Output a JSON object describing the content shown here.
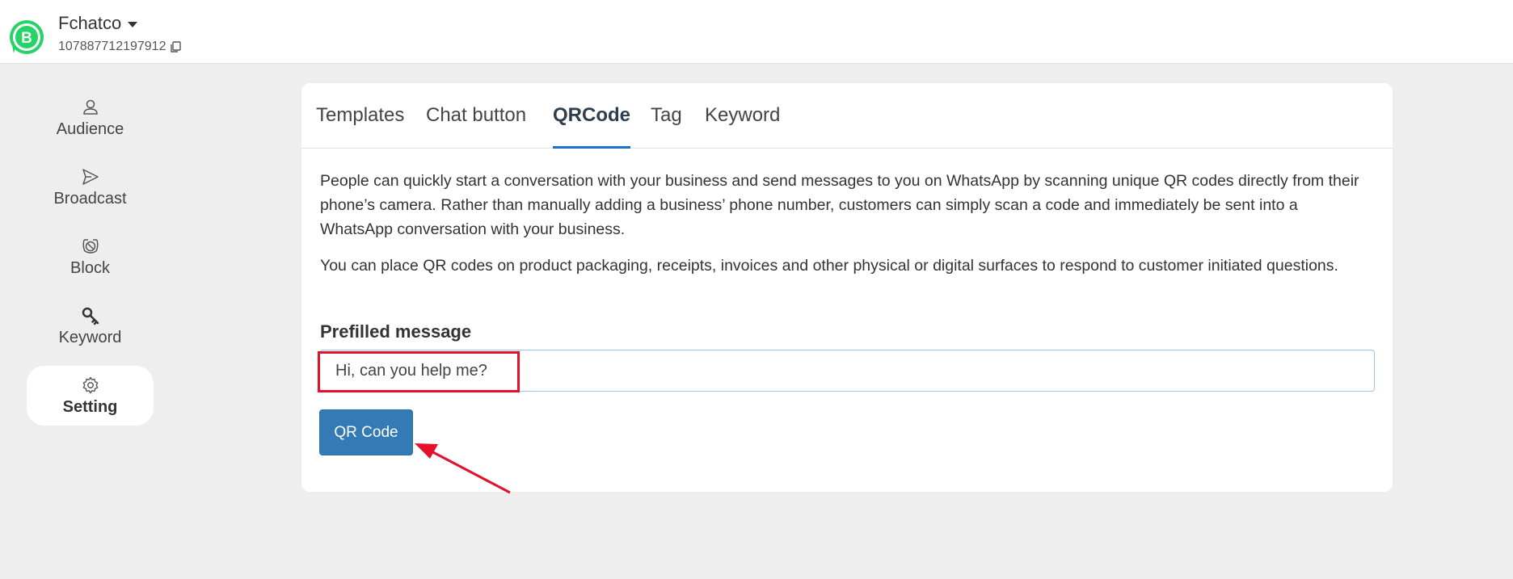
{
  "header": {
    "account_name": "Fchatco",
    "account_id": "107887712197912",
    "logo_letter": "B"
  },
  "sidebar": {
    "items": [
      {
        "label": "Audience",
        "icon": "user-icon"
      },
      {
        "label": "Broadcast",
        "icon": "send-icon"
      },
      {
        "label": "Block",
        "icon": "block-icon"
      },
      {
        "label": "Keyword",
        "icon": "key-icon"
      },
      {
        "label": "Setting",
        "icon": "gear-icon",
        "active": true
      }
    ]
  },
  "tabs": [
    {
      "label": "Templates"
    },
    {
      "label": "Chat button"
    },
    {
      "label": "QRCode",
      "active": true
    },
    {
      "label": "Tag"
    },
    {
      "label": "Keyword"
    }
  ],
  "content": {
    "paragraph1": "People can quickly start a conversation with your business and send messages to you on WhatsApp by scanning unique QR codes directly from their phone’s camera. Rather than manually adding a business’ phone number, customers can simply scan a code and immediately be sent into a WhatsApp conversation with your business.",
    "paragraph2": "You can place QR codes on product packaging, receipts, invoices and other physical or digital surfaces to respond to customer initiated questions.",
    "field_label": "Prefilled message",
    "input_value": "Hi, can you help me?",
    "button_label": "QR Code"
  },
  "colors": {
    "brand_green": "#25d366",
    "primary_button": "#337ab7",
    "active_tab_underline": "#1e6fd0",
    "annotation_red": "#e3112b"
  }
}
